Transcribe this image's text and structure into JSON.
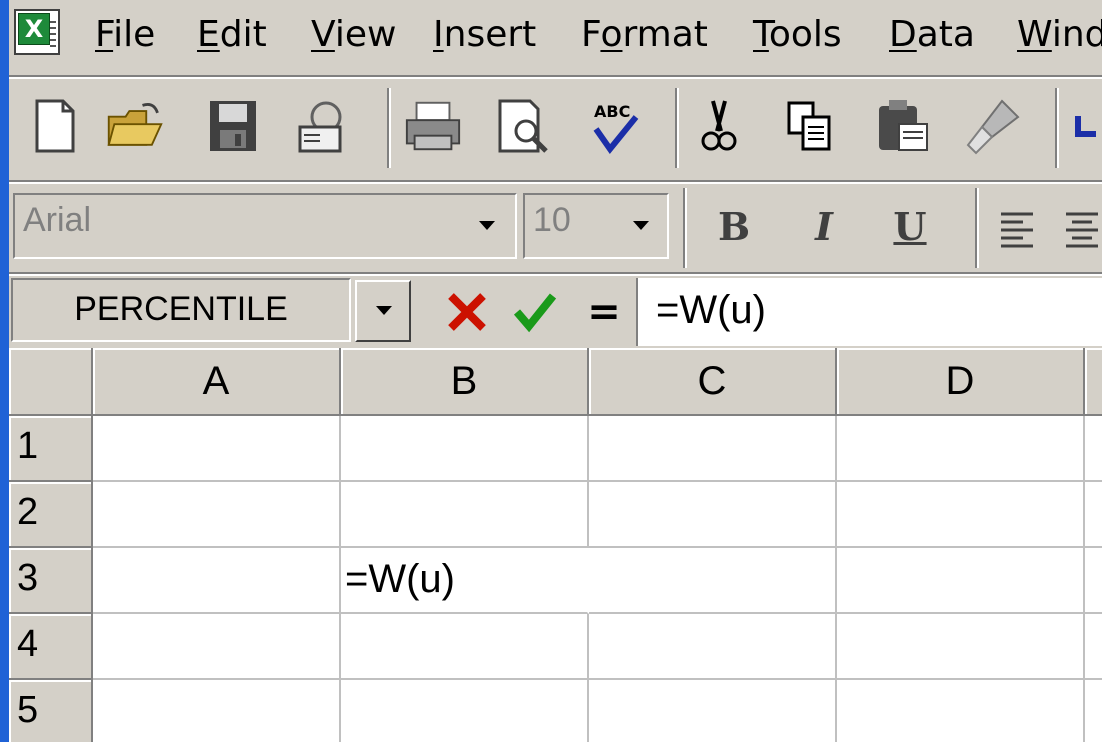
{
  "menu": {
    "items": [
      {
        "pre": "",
        "mnemonic": "F",
        "post": "ile"
      },
      {
        "pre": "",
        "mnemonic": "E",
        "post": "dit"
      },
      {
        "pre": "",
        "mnemonic": "V",
        "post": "iew"
      },
      {
        "pre": "",
        "mnemonic": "I",
        "post": "nsert"
      },
      {
        "pre": "F",
        "mnemonic": "o",
        "post": "rmat"
      },
      {
        "pre": "",
        "mnemonic": "T",
        "post": "ools"
      },
      {
        "pre": "",
        "mnemonic": "D",
        "post": "ata"
      },
      {
        "pre": "",
        "mnemonic": "W",
        "post": "indow"
      }
    ]
  },
  "formatting": {
    "font_name": "Arial",
    "font_size": "10",
    "bold_label": "B",
    "italic_label": "I",
    "underline_label": "U"
  },
  "formula_bar": {
    "name_box": "PERCENTILE",
    "equals_label": "=",
    "formula": "=W(u)"
  },
  "grid": {
    "columns": [
      "A",
      "B",
      "C",
      "D"
    ],
    "rows": [
      "1",
      "2",
      "3",
      "4",
      "5"
    ],
    "cells": {
      "B3": "=W(u)"
    }
  },
  "colors": {
    "desktop": "#1f62d6",
    "chrome": "#d4d0c8",
    "cancel_red": "#cc1100",
    "enter_green": "#1a9a1a"
  }
}
